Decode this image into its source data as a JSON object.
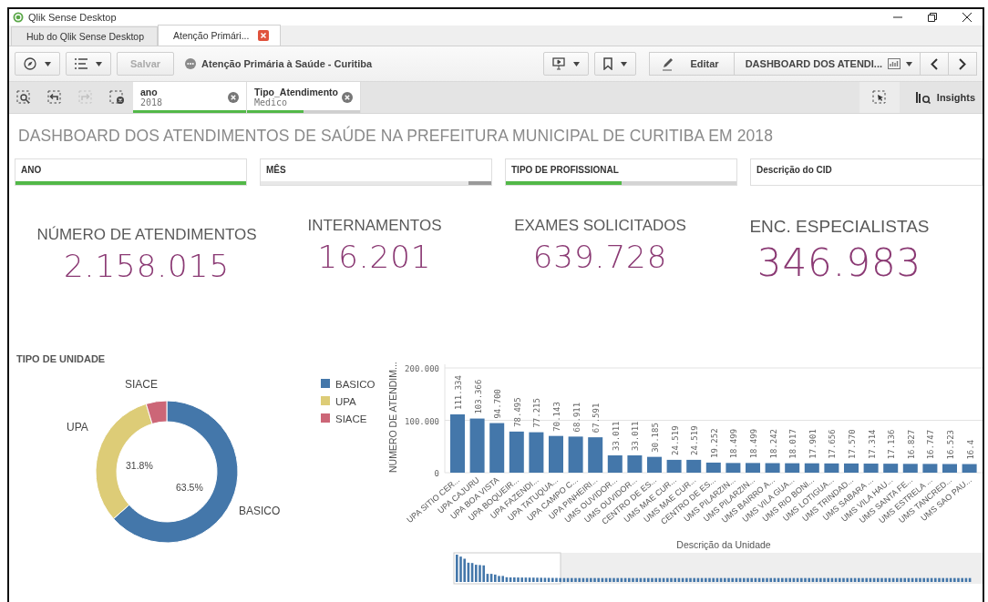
{
  "window": {
    "title": "Qlik Sense Desktop"
  },
  "tabs": [
    {
      "label": "Hub do Qlik Sense Desktop",
      "selected": false,
      "closable": false
    },
    {
      "label": "Atenção Primári...",
      "selected": true,
      "closable": true
    }
  ],
  "toolbar": {
    "save_label": "Salvar",
    "app_title": "Atenção Primária à Saúde - Curitiba",
    "edit_label": "Editar",
    "sheet_label": "DASHBOARD DOS ATENDI..."
  },
  "selection_tools": [
    {
      "kind": "search",
      "disabled": false
    },
    {
      "kind": "back",
      "disabled": false
    },
    {
      "kind": "forward",
      "disabled": true
    },
    {
      "kind": "clear",
      "disabled": false
    }
  ],
  "selections": [
    {
      "field": "ano",
      "value": "2018",
      "level": 1
    },
    {
      "field": "Tipo_Atendimento",
      "value": "Medico",
      "level": 0.5
    }
  ],
  "insights_label": "Insights",
  "sheet_title": "DASHBOARD DOS ATENDIMENTOS DE SAÚDE NA PREFEITURA MUNICIPAL DE CURITIBA EM 2018",
  "filters": [
    {
      "label": "ANO",
      "kind": "selected"
    },
    {
      "label": "MÊS",
      "kind": "excluded"
    },
    {
      "label": "TIPO DE PROFISSIONAL",
      "kind": "partial"
    },
    {
      "label": "Descrição do CID",
      "kind": "none"
    }
  ],
  "kpis": [
    {
      "title": "NÚMERO DE ATENDIMENTOS",
      "value": "2.158.015"
    },
    {
      "title": "INTERNAMENTOS",
      "value": "16.201"
    },
    {
      "title": "EXAMES SOLICITADOS",
      "value": "639.728"
    },
    {
      "title": "ENC. ESPECIALISTAS",
      "value": "346.983"
    }
  ],
  "donut": {
    "title": "TIPO DE UNIDADE",
    "chart_data": {
      "type": "donut",
      "categories": [
        "BASICO",
        "UPA",
        "SIACE"
      ],
      "values": [
        63.5,
        31.8,
        4.7
      ],
      "colors": [
        "#4477aa",
        "#ddcc77",
        "#cc6677"
      ],
      "legend": "right",
      "value_labels": [
        "63.5%",
        "31.8%",
        null
      ]
    }
  },
  "bars": {
    "chart_data": {
      "type": "bar",
      "xlabel": "Descrição da Unidade",
      "ylabel": "NÚMERO DE ATENDIM...",
      "categories": [
        "UPA SITIO CER...",
        "UPA CAJURU",
        "UPA BOA VISTA",
        "UPA BOQUEIR...",
        "UPA FAZENDI...",
        "UPA TATUQUA...",
        "UPA CAMPO C...",
        "UPA PINHEIRI...",
        "UMS OUVIDOR...",
        "UMS OUVIDOR...",
        "CENTRO DE ES...",
        "UMS MAE CUR...",
        "UMS MAE CUR...",
        "CENTRO DE ES...",
        "UMS PILARZIN...",
        "UMS PILARZIN...",
        "UMS BAIRRO A...",
        "UMS VILA GUA...",
        "UMS RIO BONI...",
        "UMS LOTIGUA...",
        "UMS TRINDAD...",
        "UMS SABARA ...",
        "UMS VILA HAU...",
        "UMS SANTA FE...",
        "UMS ESTRELA ...",
        "UMS TANCRED...",
        "UMS SAO PAU..."
      ],
      "series": [
        {
          "color": "#4477aa",
          "values": [
            111.334,
            103.366,
            94.7,
            78.495,
            77.215,
            70.143,
            68.911,
            67.591,
            33.011,
            33.011,
            30.185,
            24.519,
            24.519,
            19.252,
            18.499,
            18.499,
            18.242,
            18.017,
            17.901,
            17.656,
            17.57,
            17.314,
            17.136,
            16.827,
            16.747,
            16.523,
            16.439
          ]
        }
      ],
      "value_labels": [
        "111.334",
        "103.366",
        "94.700",
        "78.495",
        "77.215",
        "70.143",
        "68.911",
        "67.591",
        "33.011",
        "33.011",
        "30.185",
        "24.519",
        "24.519",
        "19.252",
        "18.499",
        "18.499",
        "18.242",
        "18.017",
        "17.901",
        "17.656",
        "17.570",
        "17.314",
        "17.136",
        "16.827",
        "16.747",
        "16.523",
        "16.4"
      ],
      "ylim": [
        0,
        200
      ],
      "yticks": [
        {
          "value": 0,
          "label": "0"
        },
        {
          "value": 100,
          "label": "100.000"
        },
        {
          "value": 200,
          "label": "200.000"
        }
      ]
    }
  }
}
